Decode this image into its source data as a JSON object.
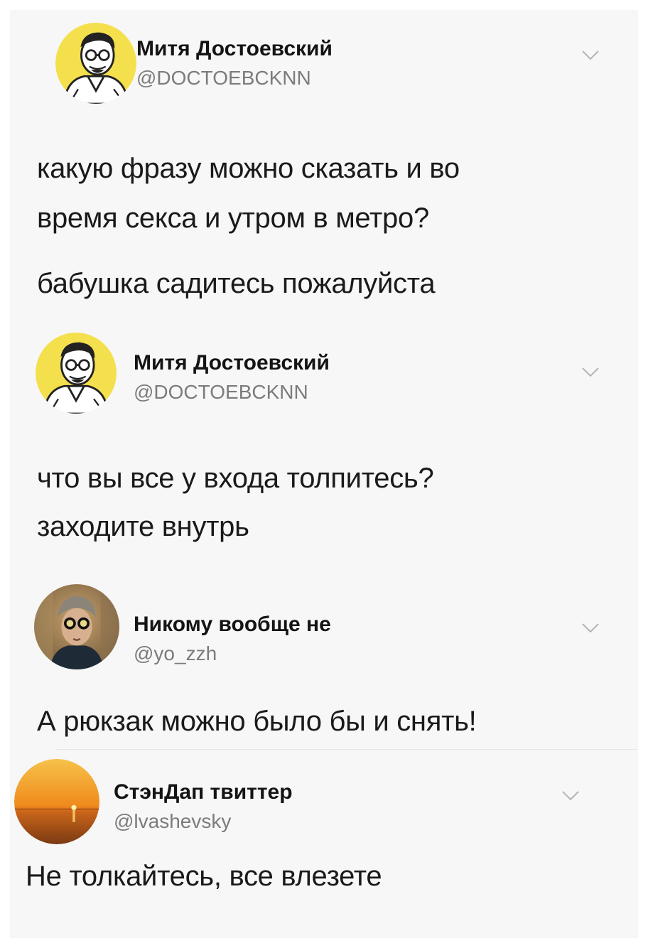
{
  "tweets": [
    {
      "name": "Митя Достоевский",
      "handle": "@DOCTOEBCKNN",
      "lines": [
        "какую фразу можно сказать и во",
        "время секса и утром в метро?"
      ],
      "reply": "бабушка садитесь пожалуйста",
      "avatar": "illustrated-man-with-glasses-avatar"
    },
    {
      "name": "Митя Достоевский",
      "handle": "@DOCTOEBCKNN",
      "lines": [
        "что вы все у входа толпитесь?",
        "заходите внутрь"
      ],
      "avatar": "illustrated-man-with-glasses-avatar"
    },
    {
      "name": "Никому вообще не",
      "handle": "@yo_zzh",
      "lines": [
        "А рюкзак можно было бы и снять!"
      ],
      "avatar": "man-with-round-goggles-photo-avatar"
    },
    {
      "name": "СтэнДап твиттер",
      "handle": "@lvashevsky",
      "lines": [
        "Не толкайтесь, все влезете"
      ],
      "avatar": "sunset-over-sea-avatar"
    }
  ],
  "icons": {
    "menu": "chevron-down-icon"
  },
  "colors": {
    "avatar_yellow": "#f4e04d",
    "handle_gray": "#7c7c7c",
    "sunset_orange": "#f08a1c"
  }
}
